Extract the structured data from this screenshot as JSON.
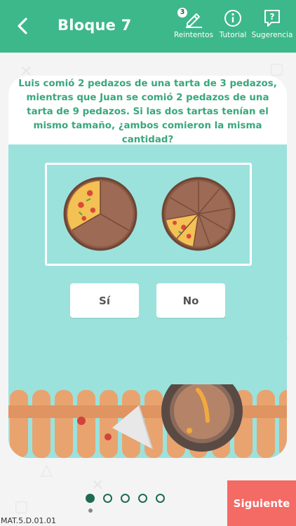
{
  "header": {
    "title": "Bloque 7",
    "back_icon": "chevron-left-icon",
    "tools": [
      {
        "label": "Reintentos",
        "icon": "pencil-icon",
        "badge": "3"
      },
      {
        "label": "Tutorial",
        "icon": "info-icon"
      },
      {
        "label": "Sugerencia",
        "icon": "question-bubble-icon"
      }
    ]
  },
  "question": {
    "text": "Luis comió 2 pedazos de una tarta de 3 pedazos, mientras que Juan se comió 2 pedazos de una tarta de 9 pedazos. Si las dos tartas tenían el mismo tamaño, ¿ambos comieron la misma cantidad?"
  },
  "pizzas": [
    {
      "slices_total": 3,
      "slices_eaten": 2
    },
    {
      "slices_total": 9,
      "slices_eaten": 2
    }
  ],
  "answers": {
    "yes_label": "Sí",
    "no_label": "No"
  },
  "pagination": {
    "total": 5,
    "current": 1
  },
  "footer": {
    "next_label": "Siguiente",
    "code": "MAT.5.D.01.01"
  },
  "colors": {
    "primary": "#3db88a",
    "question_text": "#3aa77d",
    "scene_bg": "#9be2dd",
    "next_button": "#f46a64",
    "page_dot": "#1e6b50"
  }
}
